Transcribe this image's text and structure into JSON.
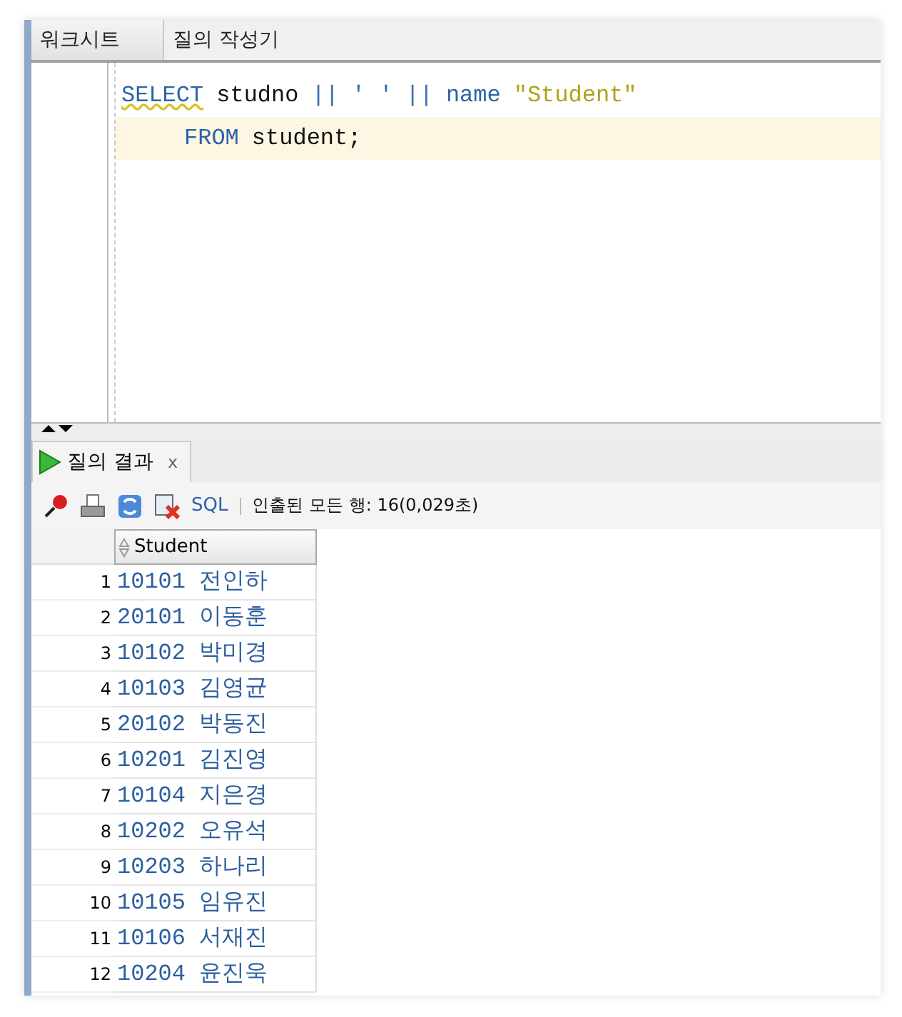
{
  "editor_tabs": [
    {
      "label": "워크시트",
      "selected": true
    },
    {
      "label": "질의 작성기",
      "selected": false
    }
  ],
  "code_lines": [
    {
      "current": false,
      "kind": "statement",
      "tokens": [
        {
          "kind": "keyword",
          "text": "SELECT",
          "flagged": true
        },
        {
          "kind": "plain",
          "text": "studno",
          "flagged": false
        },
        {
          "kind": "operator",
          "text": "||",
          "flagged": false
        },
        {
          "kind": "operator",
          "text": "' '",
          "flagged": false
        },
        {
          "kind": "operator",
          "text": "||",
          "flagged": false
        },
        {
          "kind": "keyword",
          "text": "name",
          "flagged": false
        },
        {
          "kind": "string",
          "text": "\"Student\"",
          "flagged": false
        }
      ]
    },
    {
      "current": true,
      "kind": "continuation",
      "tokens": [
        {
          "kind": "keyword",
          "text": "FROM",
          "flagged": false
        },
        {
          "kind": "plain",
          "text": "student;",
          "flagged": false
        }
      ]
    }
  ],
  "result_tab": {
    "label": "질의 결과",
    "close": "x"
  },
  "toolbar": {
    "sql_link": "SQL",
    "status": "인출된 모든 행: 16(0,029초)"
  },
  "grid": {
    "columns": [
      "Student"
    ],
    "rows": [
      {
        "num": "1",
        "value": "10101 전인하"
      },
      {
        "num": "2",
        "value": "20101 이동훈"
      },
      {
        "num": "3",
        "value": "10102 박미경"
      },
      {
        "num": "4",
        "value": "10103 김영균"
      },
      {
        "num": "5",
        "value": "20102 박동진"
      },
      {
        "num": "6",
        "value": "10201 김진영"
      },
      {
        "num": "7",
        "value": "10104 지은경"
      },
      {
        "num": "8",
        "value": "10202 오유석"
      },
      {
        "num": "9",
        "value": "10203 하나리"
      },
      {
        "num": "10",
        "value": "10105 임유진"
      },
      {
        "num": "11",
        "value": "10106 서재진"
      },
      {
        "num": "12",
        "value": "10204 윤진욱"
      }
    ]
  }
}
